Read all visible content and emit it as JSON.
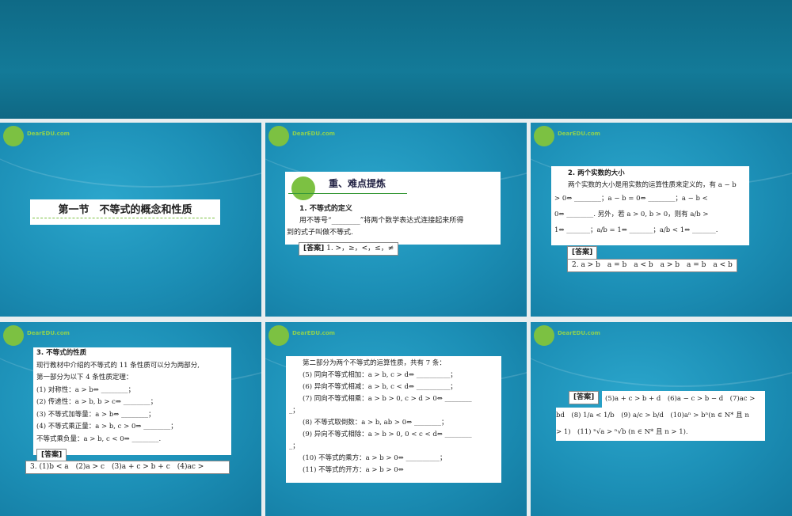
{
  "logo_text": "DearEDU.com",
  "s1": {
    "title": "第一节　不等式的概念和性质"
  },
  "s2": {
    "header": "重、难点提炼",
    "h1": "1. 不等式的定义",
    "p1": "用不等号“________”将两个数学表达式连接起来所得",
    "p2": "到的式子叫做不等式.",
    "ans_label": "[答案]",
    "ans": "1. >，≥，<，≤，≠"
  },
  "s3": {
    "h": "2. 两个实数的大小",
    "l1": "两个实数的大小是用实数的运算性质来定义的，有 a − b",
    "l2": "> 0⇔ ________；a − b = 0⇔ ________；a − b <",
    "l3": "0⇔ ________. 另外，若 a > 0, b > 0，则有 a/b >",
    "l4": "1⇔ _______；a/b = 1⇔ _______；a/b < 1⇔ _______.",
    "ans_label": "[答案]",
    "ans": "2. a > b　a = b　a < b　a > b　a = b　a < b"
  },
  "s4": {
    "h": "3. 不等式的性质",
    "l1": "现行教材中介绍的不等式的 11 条性质可以分为两部分,",
    "l2": "第一部分为以下 4 条性质定理：",
    "l3": "(1) 对称性：a > b⇔ ________；",
    "l4": "(2) 传递性：a > b, b > c⇔ ________；",
    "l5": "(3) 不等式加等量：a > b⇔ ________；",
    "l6": "(4) 不等式乘正量：a > b, c > 0⇒ ________；",
    "l7": "不等式乘负量：a > b, c < 0⇒ ________.",
    "ans_label": "[答案]",
    "ans": "3. (1)b < a　(2)a > c　(3)a + c > b + c　(4)ac >"
  },
  "s5": {
    "l1": "第二部分为两个不等式的运算性质，共有 7 条：",
    "l2": "(5) 同向不等式相加：a > b, c > d⇔ __________；",
    "l3": "(6) 异向不等式相减：a > b, c < d⇔ __________；",
    "l4": "(7) 同向不等式相乘：a > b > 0, c > d > 0⇔ ________",
    "l5": "_；",
    "l6": "(8) 不等式取倒数：a > b, ab > 0⇔ ________；",
    "l7": "(9) 异向不等式相除：a > b > 0, 0 < c < d⇔ ________",
    "l8": "_；",
    "l9": "(10) 不等式的乘方：a > b > 0⇔ __________；",
    "l10": "(11) 不等式的开方：a > b > 0⇔"
  },
  "s6": {
    "ans_label": "[答案]",
    "l1": "(5)a + c > b + d　(6)a − c > b − d　(7)ac >",
    "l2": "bd　(8) 1/a < 1/b　(9) a/c > b/d　(10)aⁿ > bⁿ(n ∈ N* 且 n",
    "l3": "> 1)　(11) ⁿ√a > ⁿ√b (n ∈ N* 且 n > 1)."
  }
}
